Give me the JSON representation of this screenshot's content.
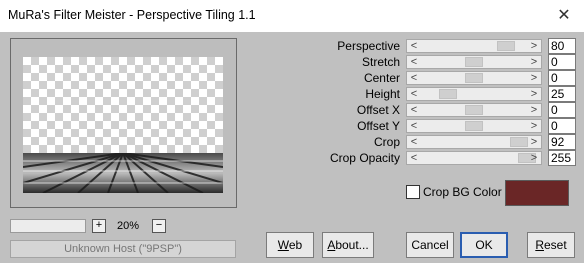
{
  "window": {
    "title": "MuRa's Filter Meister - Perspective Tiling 1.1",
    "close_glyph": "✕"
  },
  "preview": {
    "zoom_minus": "−",
    "zoom_plus": "+",
    "zoom_level": "20%"
  },
  "host_status": "Unknown Host (\"9PSP\")",
  "params": [
    {
      "label": "Perspective",
      "value": "80",
      "slider_fraction": 0.8
    },
    {
      "label": "Stretch",
      "value": "0",
      "slider_fraction": 0.5
    },
    {
      "label": "Center",
      "value": "0",
      "slider_fraction": 0.5
    },
    {
      "label": "Height",
      "value": "25",
      "slider_fraction": 0.25
    },
    {
      "label": "Offset X",
      "value": "0",
      "slider_fraction": 0.5
    },
    {
      "label": "Offset Y",
      "value": "0",
      "slider_fraction": 0.5
    },
    {
      "label": "Crop",
      "value": "92",
      "slider_fraction": 0.92
    },
    {
      "label": "Crop Opacity",
      "value": "255",
      "slider_fraction": 1.0
    }
  ],
  "crop_bg": {
    "label": "Crop BG Color",
    "checked": false,
    "color": "#6a2626"
  },
  "buttons": {
    "web": {
      "prefix": "",
      "accel": "W",
      "rest": "eb"
    },
    "about": {
      "prefix": "",
      "accel": "A",
      "rest": "bout..."
    },
    "cancel": "Cancel",
    "ok": "OK",
    "reset": {
      "prefix": "",
      "accel": "R",
      "rest": "eset"
    }
  },
  "arrows": {
    "left": "<",
    "right": ">"
  }
}
